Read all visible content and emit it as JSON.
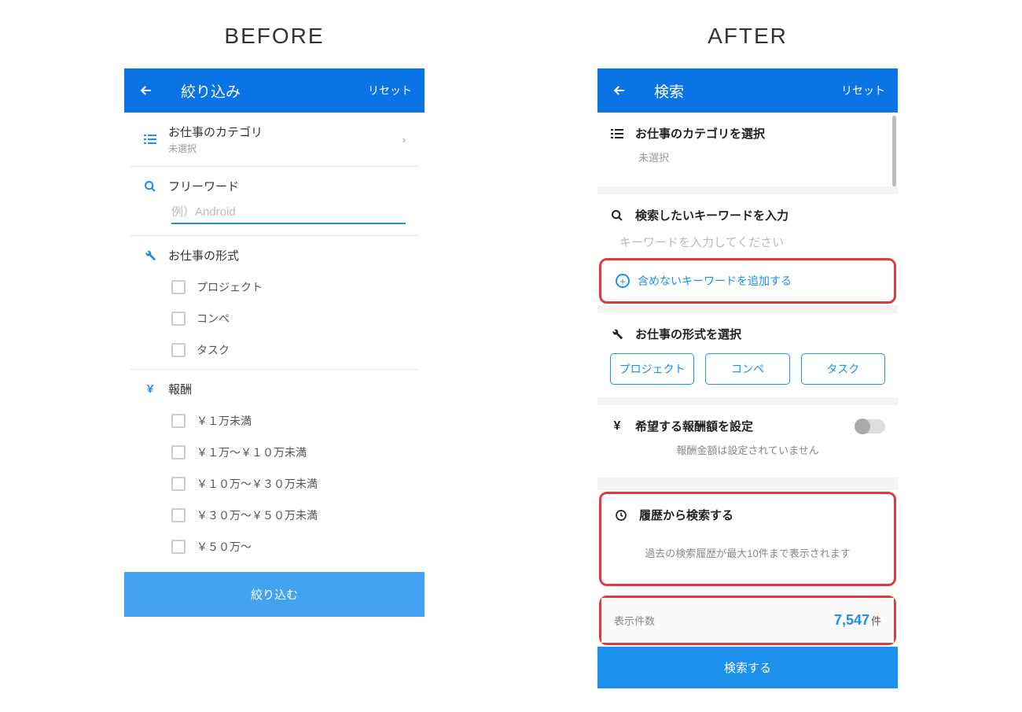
{
  "labels": {
    "before": "BEFORE",
    "after": "AFTER"
  },
  "before": {
    "header": {
      "title": "絞り込み",
      "reset": "リセット"
    },
    "category": {
      "label": "お仕事のカテゴリ",
      "sub": "未選択"
    },
    "freeword": {
      "label": "フリーワード",
      "placeholder": "例）Android"
    },
    "format": {
      "label": "お仕事の形式",
      "opts": [
        "プロジェクト",
        "コンペ",
        "タスク"
      ]
    },
    "fee": {
      "label": "報酬",
      "opts": [
        "￥１万未満",
        "￥１万～￥１０万未満",
        "￥１０万～￥３０万未満",
        "￥３０万～￥５０万未満",
        "￥５０万～"
      ]
    },
    "cta": "絞り込む"
  },
  "after": {
    "header": {
      "title": "検索",
      "reset": "リセット"
    },
    "category": {
      "label": "お仕事のカテゴリを選択",
      "sub": "未選択"
    },
    "keyword": {
      "label": "検索したいキーワードを入力",
      "placeholder": "キーワードを入力してください"
    },
    "exclude": "含めないキーワードを追加する",
    "format": {
      "label": "お仕事の形式を選択",
      "opts": [
        "プロジェクト",
        "コンペ",
        "タスク"
      ]
    },
    "fee": {
      "label": "希望する報酬額を設定",
      "note": "報酬金額は設定されていません"
    },
    "history": {
      "label": "履歴から検索する",
      "note": "過去の検索履歴が最大10件まで表示されます"
    },
    "count": {
      "label": "表示件数",
      "value": "7,547",
      "unit": "件"
    },
    "cta": "検索する"
  }
}
